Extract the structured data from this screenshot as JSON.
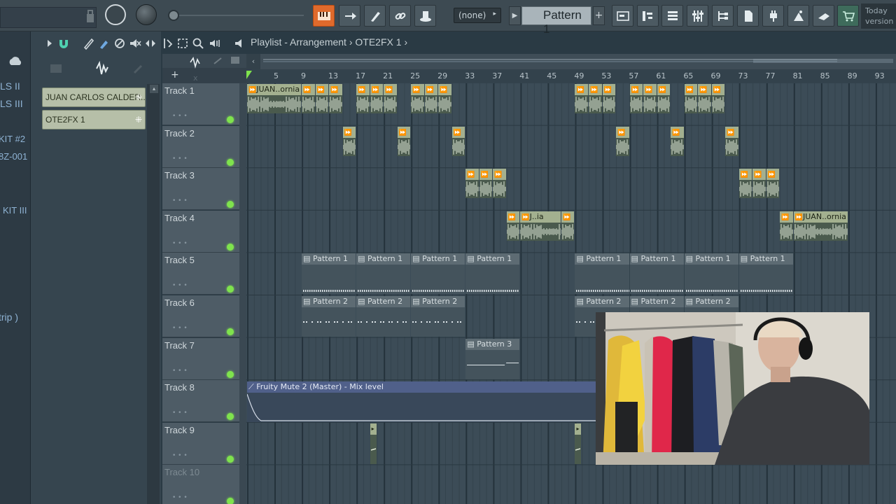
{
  "toolbar": {
    "pattern_selector": "Pattern 1",
    "none_selector": "(none)",
    "hint_line1": "Today",
    "hint_line2": "version"
  },
  "left_strip": {
    "labels": [
      "LS II",
      "LS III",
      "KIT #2",
      "8Z-001",
      "KIT III",
      "trip )"
    ]
  },
  "picker": {
    "items": [
      "JUAN CARLOS CALDER..",
      "OTE2FX 1"
    ]
  },
  "playlist": {
    "title": "Playlist - Arrangement",
    "breadcrumb_sep": "›",
    "pattern_name": "OTE2FX 1"
  },
  "ruler": {
    "bars": [
      "5",
      "9",
      "13",
      "17",
      "21",
      "25",
      "29",
      "33",
      "37",
      "41",
      "45",
      "49",
      "53",
      "57",
      "61",
      "65",
      "69",
      "73",
      "77",
      "81",
      "85",
      "89",
      "93"
    ]
  },
  "tracks": [
    {
      "name": "Track 1"
    },
    {
      "name": "Track 2"
    },
    {
      "name": "Track 3"
    },
    {
      "name": "Track 4"
    },
    {
      "name": "Track 5"
    },
    {
      "name": "Track 6"
    },
    {
      "name": "Track 7"
    },
    {
      "name": "Track 8"
    },
    {
      "name": "Track 9"
    },
    {
      "name": "Track 10"
    }
  ],
  "clips": {
    "audio_label_long": "JUAN..ornia",
    "audio_label_short": "J..ia",
    "pattern1": "Pattern 1",
    "pattern2": "Pattern 2",
    "pattern3": "Pattern 3",
    "automation": "Fruity Mute 2 (Master) - Mix level"
  },
  "colors": {
    "accent": "#e06a2c",
    "audio_clip": "#a3b08f",
    "pattern_clip": "#5d6b73",
    "automation_clip": "#50608a",
    "led": "#7fe34d"
  }
}
